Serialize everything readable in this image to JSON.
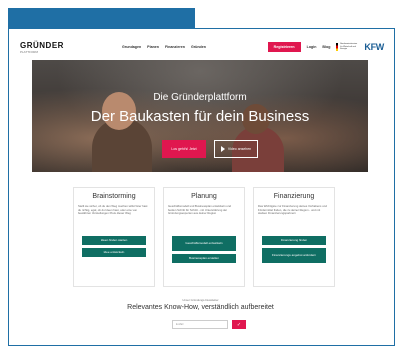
{
  "nav": {
    "logo": "GRÜNDER",
    "logo_sub": "PLATTFORM",
    "items": [
      {
        "label": "Grundagen"
      },
      {
        "label": "Planen"
      },
      {
        "label": "Finanzieren"
      },
      {
        "label": "Gründen"
      }
    ],
    "register": "Registrieren",
    "login": "Login",
    "blog": "Blog",
    "ministry": "Bundesministerium für Wirtschaft und Energie",
    "kfw": "KFW"
  },
  "hero": {
    "subtitle": "Die Gründerplattform",
    "title": "Der Baukasten für dein Business",
    "cta": "Los geht's! Jetzt",
    "video": "Video ansehen"
  },
  "columns": [
    {
      "title": "Brainstorming",
      "text": "Stellt sie sicher, ob du den Weg machen willst! Hier hast du richtig, egal, ob du Ideen hast, oder eine von bewährten Vorstellungen Preis dieser Weg",
      "buttons": [
        "Ideen finden starten",
        "Idee entwickeln"
      ]
    },
    {
      "title": "Planung",
      "text": "Geschäftsmodell und Businessplan entwickeln und beiden Schritt für Schritt - mit Unterstützung der Gründungsexperten aus deiner Region",
      "buttons": [
        "Geschäftsmodell entwickeln",
        "Businessplan erstellen"
      ]
    },
    {
      "title": "Finanzierung",
      "text": "Das Wichtigste zur Finanzierung deines Vorhabens und Fördermittel finden, die zu deiner Region - und mit starken Finanzierungspartnern",
      "buttons": [
        "Finanzierung finden",
        "Finanzierungs angebot anfordern"
      ]
    }
  ],
  "newsletter": {
    "kicker": "Unser Gründungs-Newsletter",
    "title": "Relevantes Know-How, verständlich aufbereitet",
    "placeholder": "E-Mail",
    "submit_icon": "check-icon"
  },
  "colors": {
    "accent": "#e0174f",
    "primary": "#0f6e63",
    "frame": "#1f6fa5",
    "kfw": "#1b5e95"
  }
}
